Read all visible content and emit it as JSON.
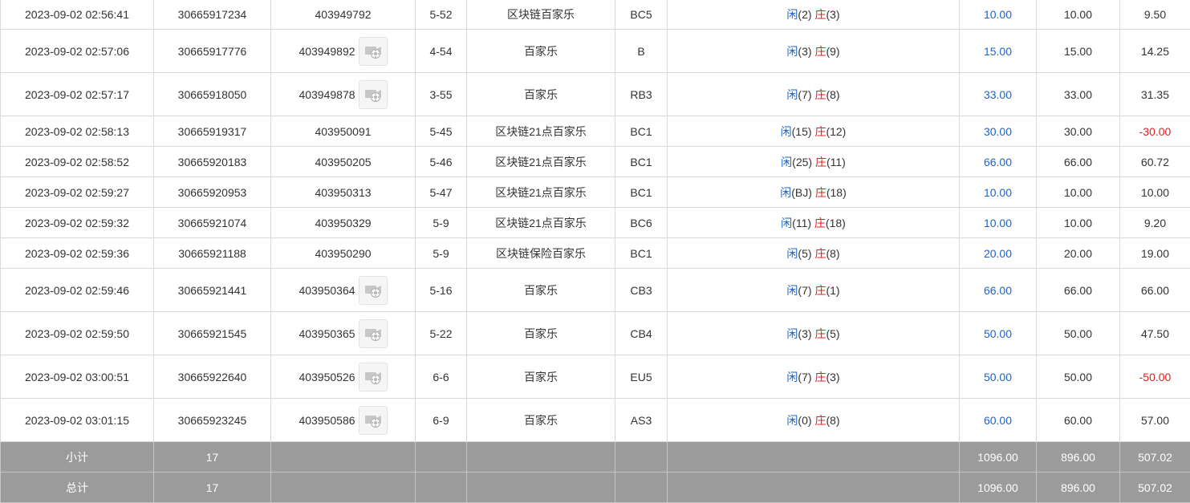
{
  "rows": [
    {
      "time": "2023-09-02 02:56:41",
      "bet_no": "30665917234",
      "round_id": "403949792",
      "video": false,
      "table": "5-52",
      "game": "区块链百家乐",
      "seat": "BC5",
      "player_label": "闲",
      "player_val": "(2)",
      "banker_label": "庄",
      "banker_val": "(3)",
      "bet": "10.00",
      "valid": "10.00",
      "result": "9.50",
      "result_neg": false,
      "h": "r38"
    },
    {
      "time": "2023-09-02 02:57:06",
      "bet_no": "30665917776",
      "round_id": "403949892",
      "video": true,
      "table": "4-54",
      "game": "百家乐",
      "seat": "B",
      "player_label": "闲",
      "player_val": "(3)",
      "banker_label": "庄",
      "banker_val": "(9)",
      "bet": "15.00",
      "valid": "15.00",
      "result": "14.25",
      "result_neg": false,
      "h": "r54"
    },
    {
      "time": "2023-09-02 02:57:17",
      "bet_no": "30665918050",
      "round_id": "403949878",
      "video": true,
      "table": "3-55",
      "game": "百家乐",
      "seat": "RB3",
      "player_label": "闲",
      "player_val": "(7)",
      "banker_label": "庄",
      "banker_val": "(8)",
      "bet": "33.00",
      "valid": "33.00",
      "result": "31.35",
      "result_neg": false,
      "h": "r54"
    },
    {
      "time": "2023-09-02 02:58:13",
      "bet_no": "30665919317",
      "round_id": "403950091",
      "video": false,
      "table": "5-45",
      "game": "区块链21点百家乐",
      "seat": "BC1",
      "player_label": "闲",
      "player_val": "(15)",
      "banker_label": "庄",
      "banker_val": "(12)",
      "bet": "30.00",
      "valid": "30.00",
      "result": "-30.00",
      "result_neg": true,
      "h": "r38"
    },
    {
      "time": "2023-09-02 02:58:52",
      "bet_no": "30665920183",
      "round_id": "403950205",
      "video": false,
      "table": "5-46",
      "game": "区块链21点百家乐",
      "seat": "BC1",
      "player_label": "闲",
      "player_val": "(25)",
      "banker_label": "庄",
      "banker_val": "(11)",
      "bet": "66.00",
      "valid": "66.00",
      "result": "60.72",
      "result_neg": false,
      "h": "r38"
    },
    {
      "time": "2023-09-02 02:59:27",
      "bet_no": "30665920953",
      "round_id": "403950313",
      "video": false,
      "table": "5-47",
      "game": "区块链21点百家乐",
      "seat": "BC1",
      "player_label": "闲",
      "player_val": "(BJ)",
      "banker_label": "庄",
      "banker_val": "(18)",
      "bet": "10.00",
      "valid": "10.00",
      "result": "10.00",
      "result_neg": false,
      "h": "r38"
    },
    {
      "time": "2023-09-02 02:59:32",
      "bet_no": "30665921074",
      "round_id": "403950329",
      "video": false,
      "table": "5-9",
      "game": "区块链21点百家乐",
      "seat": "BC6",
      "player_label": "闲",
      "player_val": "(11)",
      "banker_label": "庄",
      "banker_val": "(18)",
      "bet": "10.00",
      "valid": "10.00",
      "result": "9.20",
      "result_neg": false,
      "h": "r38"
    },
    {
      "time": "2023-09-02 02:59:36",
      "bet_no": "30665921188",
      "round_id": "403950290",
      "video": false,
      "table": "5-9",
      "game": "区块链保险百家乐",
      "seat": "BC1",
      "player_label": "闲",
      "player_val": "(5)",
      "banker_label": "庄",
      "banker_val": "(8)",
      "bet": "20.00",
      "valid": "20.00",
      "result": "19.00",
      "result_neg": false,
      "h": "r38"
    },
    {
      "time": "2023-09-02 02:59:46",
      "bet_no": "30665921441",
      "round_id": "403950364",
      "video": true,
      "table": "5-16",
      "game": "百家乐",
      "seat": "CB3",
      "player_label": "闲",
      "player_val": "(7)",
      "banker_label": "庄",
      "banker_val": "(1)",
      "bet": "66.00",
      "valid": "66.00",
      "result": "66.00",
      "result_neg": false,
      "h": "r54"
    },
    {
      "time": "2023-09-02 02:59:50",
      "bet_no": "30665921545",
      "round_id": "403950365",
      "video": true,
      "table": "5-22",
      "game": "百家乐",
      "seat": "CB4",
      "player_label": "闲",
      "player_val": "(3)",
      "banker_label": "庄",
      "banker_val": "(5)",
      "bet": "50.00",
      "valid": "50.00",
      "result": "47.50",
      "result_neg": false,
      "h": "r54"
    },
    {
      "time": "2023-09-02 03:00:51",
      "bet_no": "30665922640",
      "round_id": "403950526",
      "video": true,
      "table": "6-6",
      "game": "百家乐",
      "seat": "EU5",
      "player_label": "闲",
      "player_val": "(7)",
      "banker_label": "庄",
      "banker_val": "(3)",
      "bet": "50.00",
      "valid": "50.00",
      "result": "-50.00",
      "result_neg": true,
      "h": "r54"
    },
    {
      "time": "2023-09-02 03:01:15",
      "bet_no": "30665923245",
      "round_id": "403950586",
      "video": true,
      "table": "6-9",
      "game": "百家乐",
      "seat": "AS3",
      "player_label": "闲",
      "player_val": "(0)",
      "banker_label": "庄",
      "banker_val": "(8)",
      "bet": "60.00",
      "valid": "60.00",
      "result": "57.00",
      "result_neg": false,
      "h": "r54"
    }
  ],
  "subtotal": {
    "label": "小计",
    "count": "17",
    "bet": "1096.00",
    "valid": "896.00",
    "result": "507.02"
  },
  "total": {
    "label": "总计",
    "count": "17",
    "bet": "1096.00",
    "valid": "896.00",
    "result": "507.02"
  },
  "icons": {
    "video": "video-replay-icon"
  },
  "colors": {
    "player": "#1e63c8",
    "banker": "#e02020",
    "bet_amount": "#1e63c8",
    "negative": "#e02020",
    "total_bg": "#9b9b9b"
  }
}
